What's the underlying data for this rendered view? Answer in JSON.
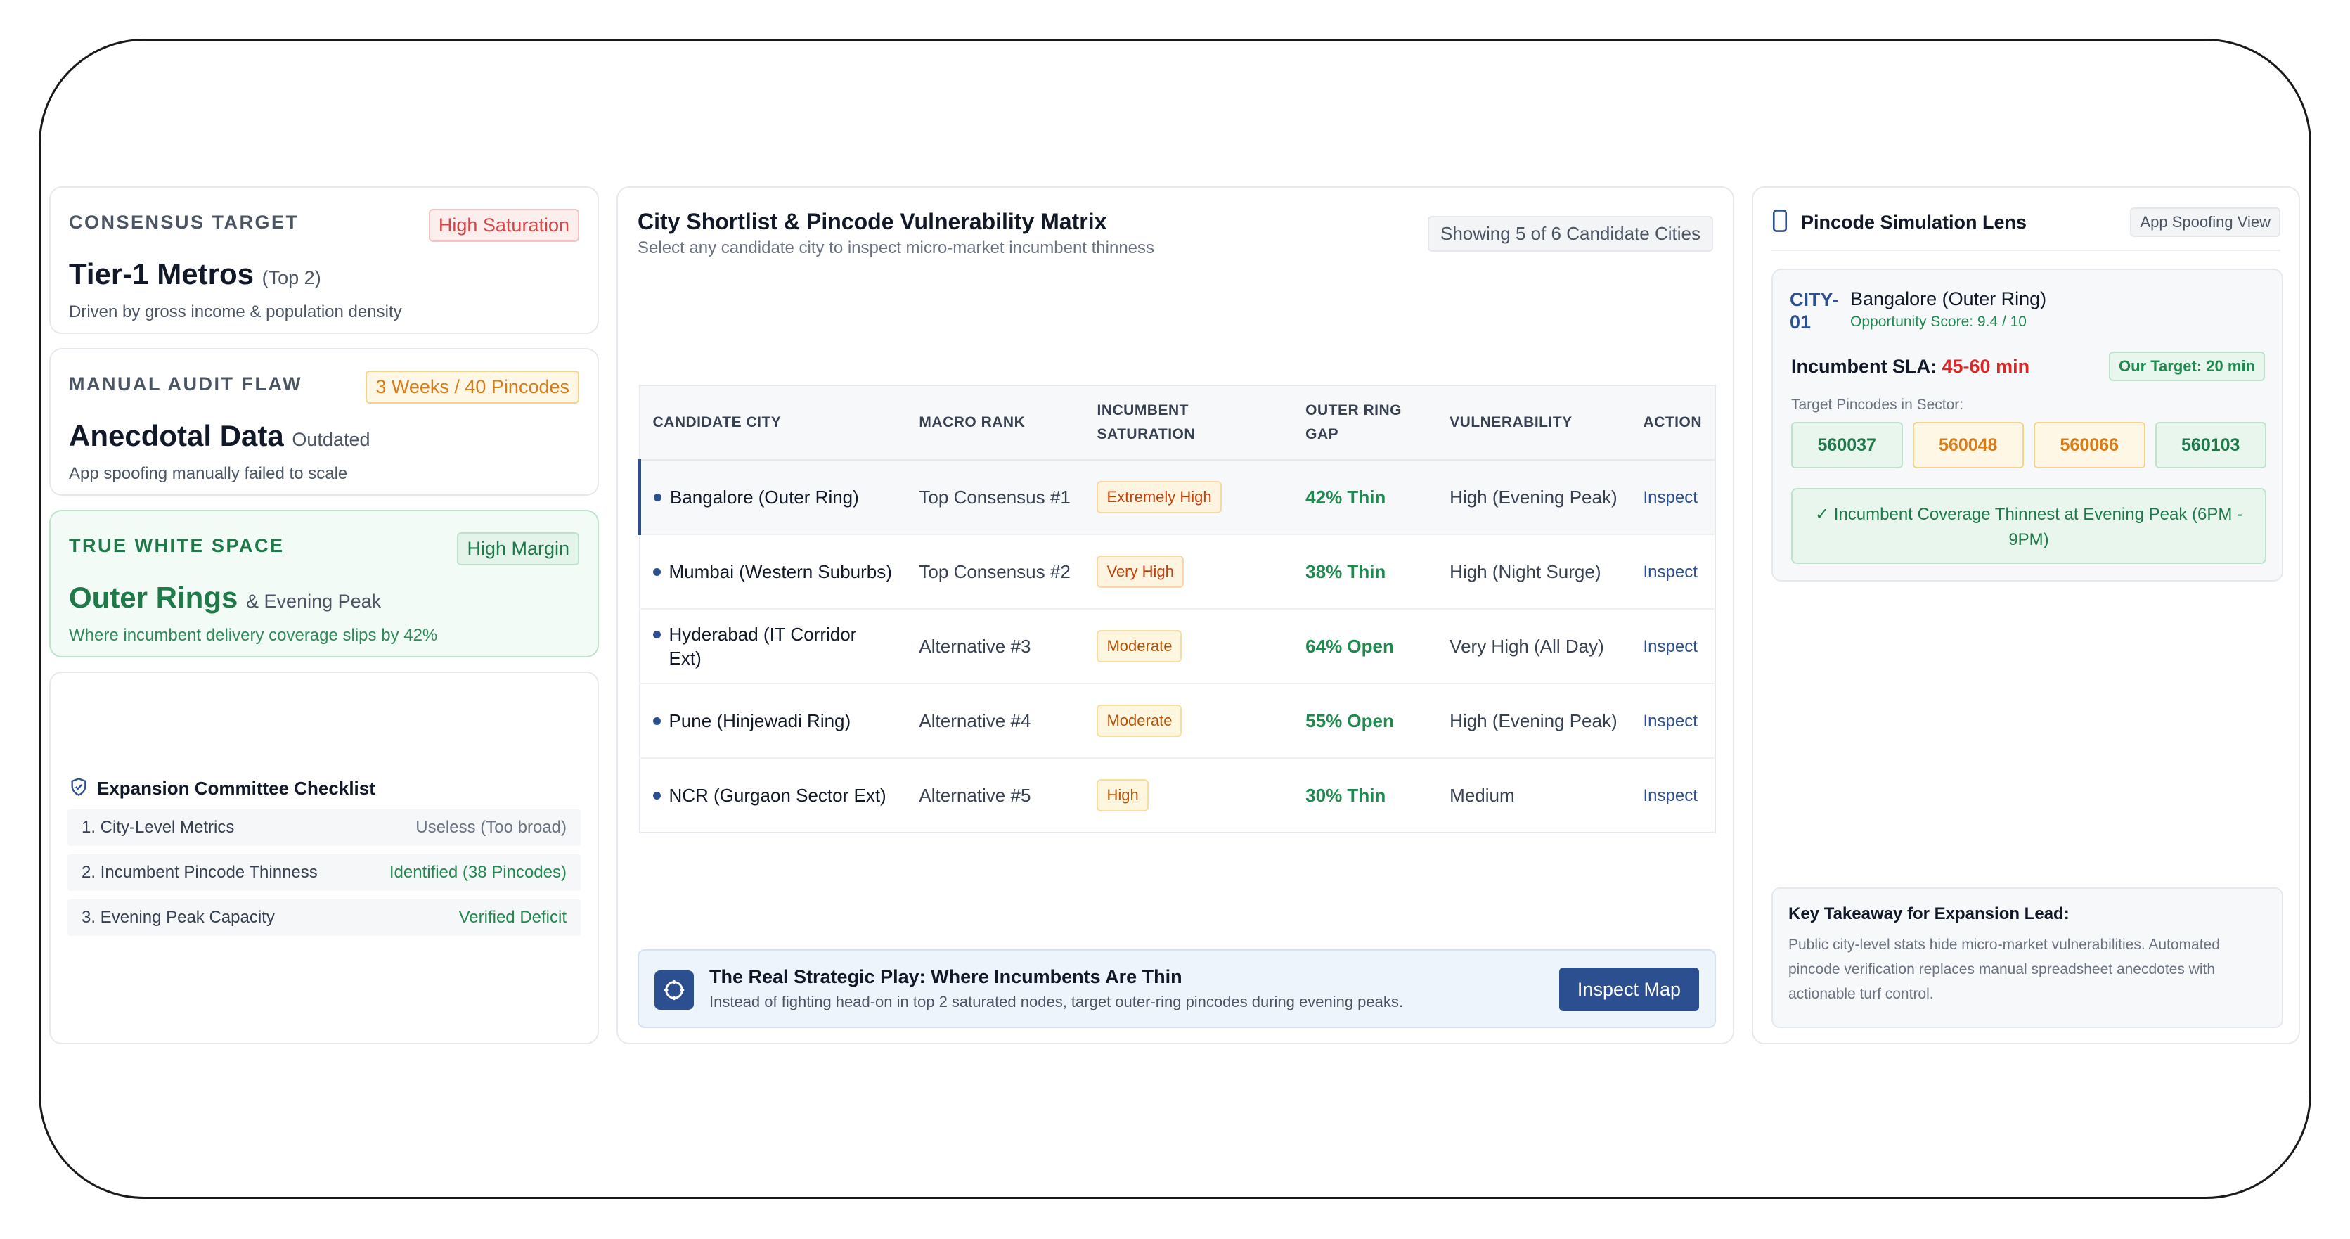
{
  "consensus": {
    "label": "CONSENSUS TARGET",
    "badge": "High Saturation",
    "title": "Tier-1 Metros",
    "title_sub": "(Top 2)",
    "desc": "Driven by gross income & population density"
  },
  "audit": {
    "label": "MANUAL AUDIT FLAW",
    "badge": "3 Weeks / 40 Pincodes",
    "title": "Anecdotal Data",
    "title_sub": "Outdated",
    "desc": "App spoofing manually failed to scale"
  },
  "whitespace": {
    "label": "TRUE WHITE SPACE",
    "badge": "High Margin",
    "title": "Outer Rings",
    "title_sub": "& Evening Peak",
    "desc": "Where incumbent delivery coverage slips by 42%"
  },
  "checklist": {
    "title": "Expansion Committee Checklist",
    "icon": "shield-check-icon",
    "rows": [
      {
        "label": "1. City-Level Metrics",
        "value": "Useless (Too broad)"
      },
      {
        "label": "2. Incumbent Pincode Thinness",
        "value": "Identified (38 Pincodes)"
      },
      {
        "label": "3. Evening Peak Capacity",
        "value": "Verified Deficit"
      }
    ]
  },
  "matrix": {
    "title": "City Shortlist & Pincode Vulnerability Matrix",
    "subtitle": "Select any candidate city to inspect micro-market incumbent thinness",
    "showing": "Showing 5 of 6 Candidate Cities",
    "headers": [
      "CANDIDATE CITY",
      "MACRO RANK",
      "INCUMBENT SATURATION",
      "OUTER RING GAP",
      "VULNERABILITY",
      "ACTION"
    ],
    "rows": [
      {
        "city": "Bangalore (Outer Ring)",
        "rank": "Top Consensus #1",
        "saturation": "Extremely High",
        "gap": "42% Thin",
        "vulnerability": "High (Evening Peak)",
        "action": "Inspect"
      },
      {
        "city": "Mumbai (Western Suburbs)",
        "rank": "Top Consensus #2",
        "saturation": "Very High",
        "gap": "38% Thin",
        "vulnerability": "High (Night Surge)",
        "action": "Inspect"
      },
      {
        "city": "Hyderabad (IT Corridor Ext)",
        "rank": "Alternative #3",
        "saturation": "Moderate",
        "gap": "64% Open",
        "vulnerability": "Very High (All Day)",
        "action": "Inspect"
      },
      {
        "city": "Pune (Hinjewadi Ring)",
        "rank": "Alternative #4",
        "saturation": "Moderate",
        "gap": "55% Open",
        "vulnerability": "High (Evening Peak)",
        "action": "Inspect"
      },
      {
        "city": "NCR (Gurgaon Sector Ext)",
        "rank": "Alternative #5",
        "saturation": "High",
        "gap": "30% Thin",
        "vulnerability": "Medium",
        "action": "Inspect"
      }
    ]
  },
  "play": {
    "icon": "crosshair-icon",
    "title": "The Real Strategic Play: Where Incumbents Are Thin",
    "desc": "Instead of fighting head-on in top 2 saturated nodes, target outer-ring pincodes during evening peaks.",
    "button": "Inspect Map"
  },
  "lens": {
    "title": "Pincode Simulation Lens",
    "icon": "phone-icon",
    "view_badge": "App Spoofing View",
    "city_id": "CITY-01",
    "city": "Bangalore (Outer Ring)",
    "score": "Opportunity Score: 9.4 / 10",
    "sla_label": "Incumbent SLA:",
    "sla_value": "45-60 min",
    "target": "Our Target: 20 min",
    "pincode_label": "Target Pincodes in Sector:",
    "pincodes": [
      "560037",
      "560048",
      "560066",
      "560103"
    ],
    "coverage_note": "✓ Incumbent Coverage Thinnest at Evening Peak (6PM - 9PM)"
  },
  "takeaway": {
    "title": "Key Takeaway for Expansion Lead:",
    "body": "Public city-level stats hide micro-market vulnerabilities. Automated pincode verification replaces manual spreadsheet anecdotes with actionable turf control."
  }
}
